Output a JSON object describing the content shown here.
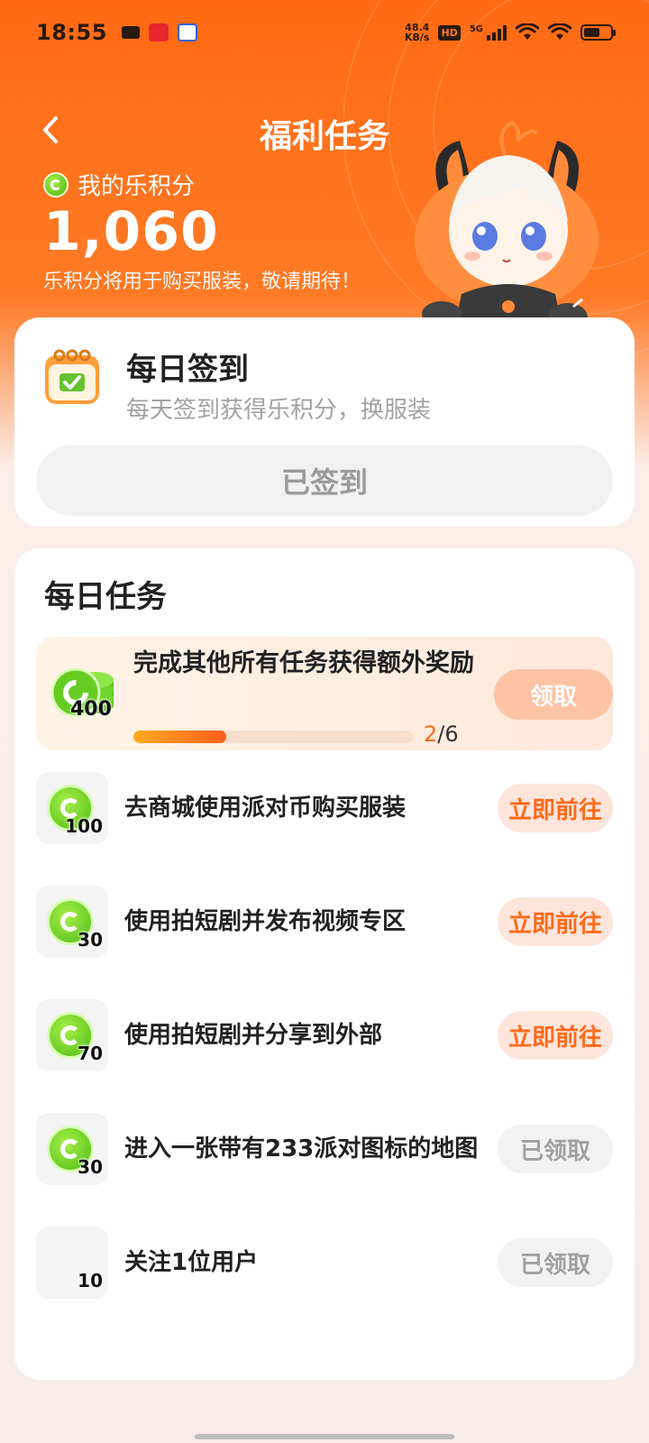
{
  "status_bar": {
    "time": "18:55",
    "net_speed_value": "48.4",
    "net_speed_unit": "KB/s",
    "hd": "HD",
    "network": "5G",
    "battery_level": 0.6
  },
  "header": {
    "title": "福利任务",
    "points_label": "我的乐积分",
    "points_value": "1,060",
    "points_note": "乐积分将用于购买服装，敬请期待！"
  },
  "checkin": {
    "title": "每日签到",
    "subtitle": "每天签到获得乐积分，换服装",
    "button_label": "已签到"
  },
  "tasks": {
    "section_title": "每日任务",
    "bonus": {
      "reward": "400",
      "text": "完成其他所有任务获得额外奖励",
      "progress_current": "2",
      "progress_total": "/6",
      "progress_fraction": 0.333,
      "button_label": "领取"
    },
    "items": [
      {
        "reward": "100",
        "label": "去商城使用派对币购买服装",
        "button": "立即前往",
        "state": "go",
        "coin": true
      },
      {
        "reward": "30",
        "label": "使用拍短剧并发布视频专区",
        "button": "立即前往",
        "state": "go",
        "coin": true
      },
      {
        "reward": "70",
        "label": "使用拍短剧并分享到外部",
        "button": "立即前往",
        "state": "go",
        "coin": true
      },
      {
        "reward": "30",
        "label": "进入一张带有233派对图标的地图",
        "button": "已领取",
        "state": "done",
        "coin": true
      },
      {
        "reward": "10",
        "label": "关注1位用户",
        "button": "已领取",
        "state": "done",
        "coin": false
      }
    ]
  },
  "colors": {
    "brand_orange": "#ff6a12",
    "accent_green": "#5ac21a",
    "go_button_text": "#ff6a1a"
  }
}
